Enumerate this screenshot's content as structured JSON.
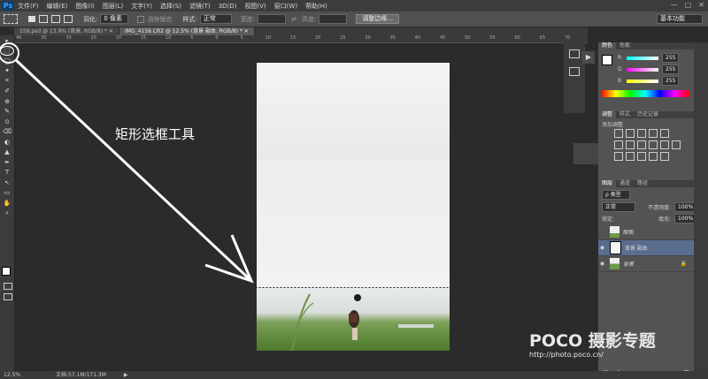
{
  "app": {
    "logo": "Ps",
    "menu": [
      "文件(F)",
      "编辑(E)",
      "图像(I)",
      "图层(L)",
      "文字(Y)",
      "选择(S)",
      "滤镜(T)",
      "3D(D)",
      "视图(V)",
      "窗口(W)",
      "帮助(H)"
    ],
    "window_controls": [
      "—",
      "□",
      "✕"
    ]
  },
  "options": {
    "feather_label": "羽化:",
    "feather_value": "0 像素",
    "antialias_label": "消除锯齿",
    "style_label": "样式:",
    "style_value": "正常",
    "width_label": "宽度:",
    "height_label": "高度:",
    "refine_button": "调整边缘...",
    "workspace": "基本功能"
  },
  "tabs": [
    {
      "label": "159.psd @ 13.9% (背景, RGB/8) *  ✕"
    },
    {
      "label": "IMG_4159.CR2 @ 12.5% (背景 副本, RGB/8) *  ✕"
    }
  ],
  "ruler_marks": [
    "40",
    "35",
    "30",
    "25",
    "20",
    "15",
    "10",
    "5",
    "0",
    "5",
    "10",
    "15",
    "20",
    "25",
    "30",
    "35",
    "40",
    "45",
    "50",
    "55",
    "60",
    "65",
    "70"
  ],
  "toolbox": {
    "tools": [
      "▸",
      "⬚",
      "◯",
      "✦",
      "⌗",
      "✐",
      "⊕",
      "✎",
      "⊙",
      "⌫",
      "◐",
      "▲",
      "✒",
      "T",
      "↖",
      "▭",
      "✋",
      "⌕"
    ]
  },
  "annotation": {
    "text": "矩形选框工具"
  },
  "panels": {
    "color": {
      "tabs": [
        "颜色",
        "色板"
      ],
      "channels": [
        {
          "label": "R",
          "value": "255",
          "color": "#e04040"
        },
        {
          "label": "G",
          "value": "255",
          "color": "#40c040"
        },
        {
          "label": "B",
          "value": "255",
          "color": "#4060e0"
        }
      ]
    },
    "adjustments": {
      "tabs": [
        "调整",
        "样式",
        "历史记录"
      ],
      "title": "添加调整"
    },
    "layers": {
      "tabs": [
        "图层",
        "通道",
        "路径"
      ],
      "kind_label": "ρ 类型",
      "blend_mode": "正常",
      "opacity_label": "不透明度:",
      "opacity_value": "100%",
      "lock_label": "锁定:",
      "fill_label": "填充:",
      "fill_value": "100%",
      "items": [
        {
          "name": "原图",
          "visible": false,
          "selected": false
        },
        {
          "name": "背景 副本",
          "visible": true,
          "selected": true
        },
        {
          "name": "背景",
          "visible": true,
          "selected": false
        }
      ],
      "footer_icons": [
        "⛓",
        "fx",
        "◐",
        "▦",
        "▢",
        "▥",
        "🗑"
      ]
    }
  },
  "status": {
    "zoom": "12.5%",
    "doc": "文档:57.1M/171.3M"
  },
  "watermark": {
    "brand": "POCO 摄影专题",
    "url": "http://photo.poco.cn/"
  }
}
